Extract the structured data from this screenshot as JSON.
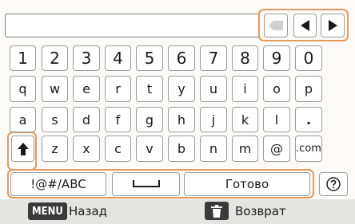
{
  "keyboard": {
    "rows": [
      [
        "1",
        "2",
        "3",
        "4",
        "5",
        "6",
        "7",
        "8",
        "9",
        "0"
      ],
      [
        "q",
        "w",
        "e",
        "r",
        "t",
        "y",
        "u",
        "i",
        "o",
        "p"
      ],
      [
        "a",
        "s",
        "d",
        "f",
        "g",
        "h",
        "j",
        "k",
        "l",
        "."
      ],
      [
        "z",
        "x",
        "c",
        "v",
        "b",
        "n",
        "m",
        "@",
        ".com"
      ]
    ],
    "mode_label": "!@#/ABC",
    "done_label": "Готово"
  },
  "bottom_bar": {
    "menu_label": "MENU",
    "back_label": "Назад",
    "return_label": "Возврат"
  },
  "colors": {
    "highlight": "#e39a5c",
    "key_border": "#9a9a9a",
    "bar_bg": "#e4e4e2"
  },
  "icons": [
    "backspace-icon",
    "cursor-left-icon",
    "cursor-right-icon",
    "shift-icon",
    "space-icon",
    "help-icon",
    "trash-icon"
  ]
}
